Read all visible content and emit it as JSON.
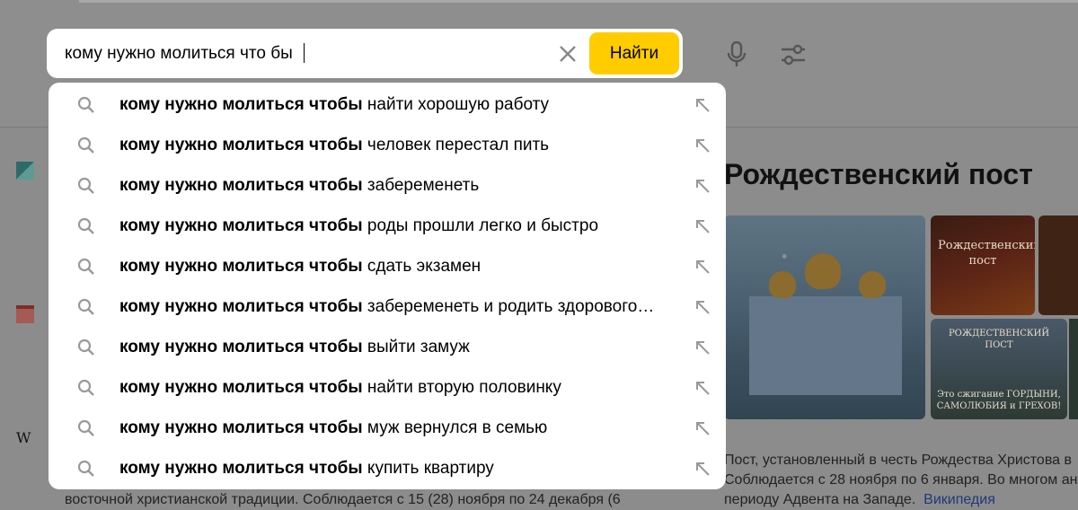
{
  "search": {
    "value": "кому нужно молиться что бы",
    "button_label": "Найти"
  },
  "suggestions": [
    {
      "bold": "кому нужно молиться чтобы",
      "rest": " найти хорошую работу"
    },
    {
      "bold": "кому нужно молиться чтобы",
      "rest": " человек перестал пить"
    },
    {
      "bold": "кому нужно молиться чтобы",
      "rest": " забеременеть"
    },
    {
      "bold": "кому нужно молиться чтобы",
      "rest": " роды прошли легко и быстро"
    },
    {
      "bold": "кому нужно молиться чтобы",
      "rest": " сдать экзамен"
    },
    {
      "bold": "кому нужно молиться чтобы",
      "rest": " забеременеть и родить здорового…"
    },
    {
      "bold": "кому нужно молиться чтобы",
      "rest": " выйти замуж"
    },
    {
      "bold": "кому нужно молиться чтобы",
      "rest": " найти вторую половинку"
    },
    {
      "bold": "кому нужно молиться чтобы",
      "rest": " муж вернулся в семью"
    },
    {
      "bold": "кому нужно молиться чтобы",
      "rest": " купить квартиру"
    }
  ],
  "knowledge_panel": {
    "title": "Рождественский пост",
    "image2_caption": "Рождественский пост",
    "image3_caption_top": "РОЖДЕСТВЕНСКИЙ ПОСТ",
    "image3_caption_bottom": "Это сжигание ГОРДЫНИ, САМОЛЮБИЯ и ГРЕХОВ!",
    "desc_line1": "Пост, установленный в честь Рождества Христова в",
    "desc_line2": "Соблюдается с 28 ноября по 6 января. Во многом ан",
    "desc_line3": "периоду Адвента на Западе.",
    "source_link": "Википедия"
  },
  "background": {
    "bottom_text": "восточной христианской традиции. Соблюдается с 15 (28) ноября по 24 декабря (6",
    "wiki_glyph": "W"
  },
  "icons": {
    "search": "search-icon",
    "arrow": "arrow-up-left-icon",
    "clear": "close-icon",
    "mic": "microphone-icon",
    "filter": "filter-icon"
  },
  "colors": {
    "accent": "#ffcc00",
    "overlay": "#8c8c8c"
  }
}
